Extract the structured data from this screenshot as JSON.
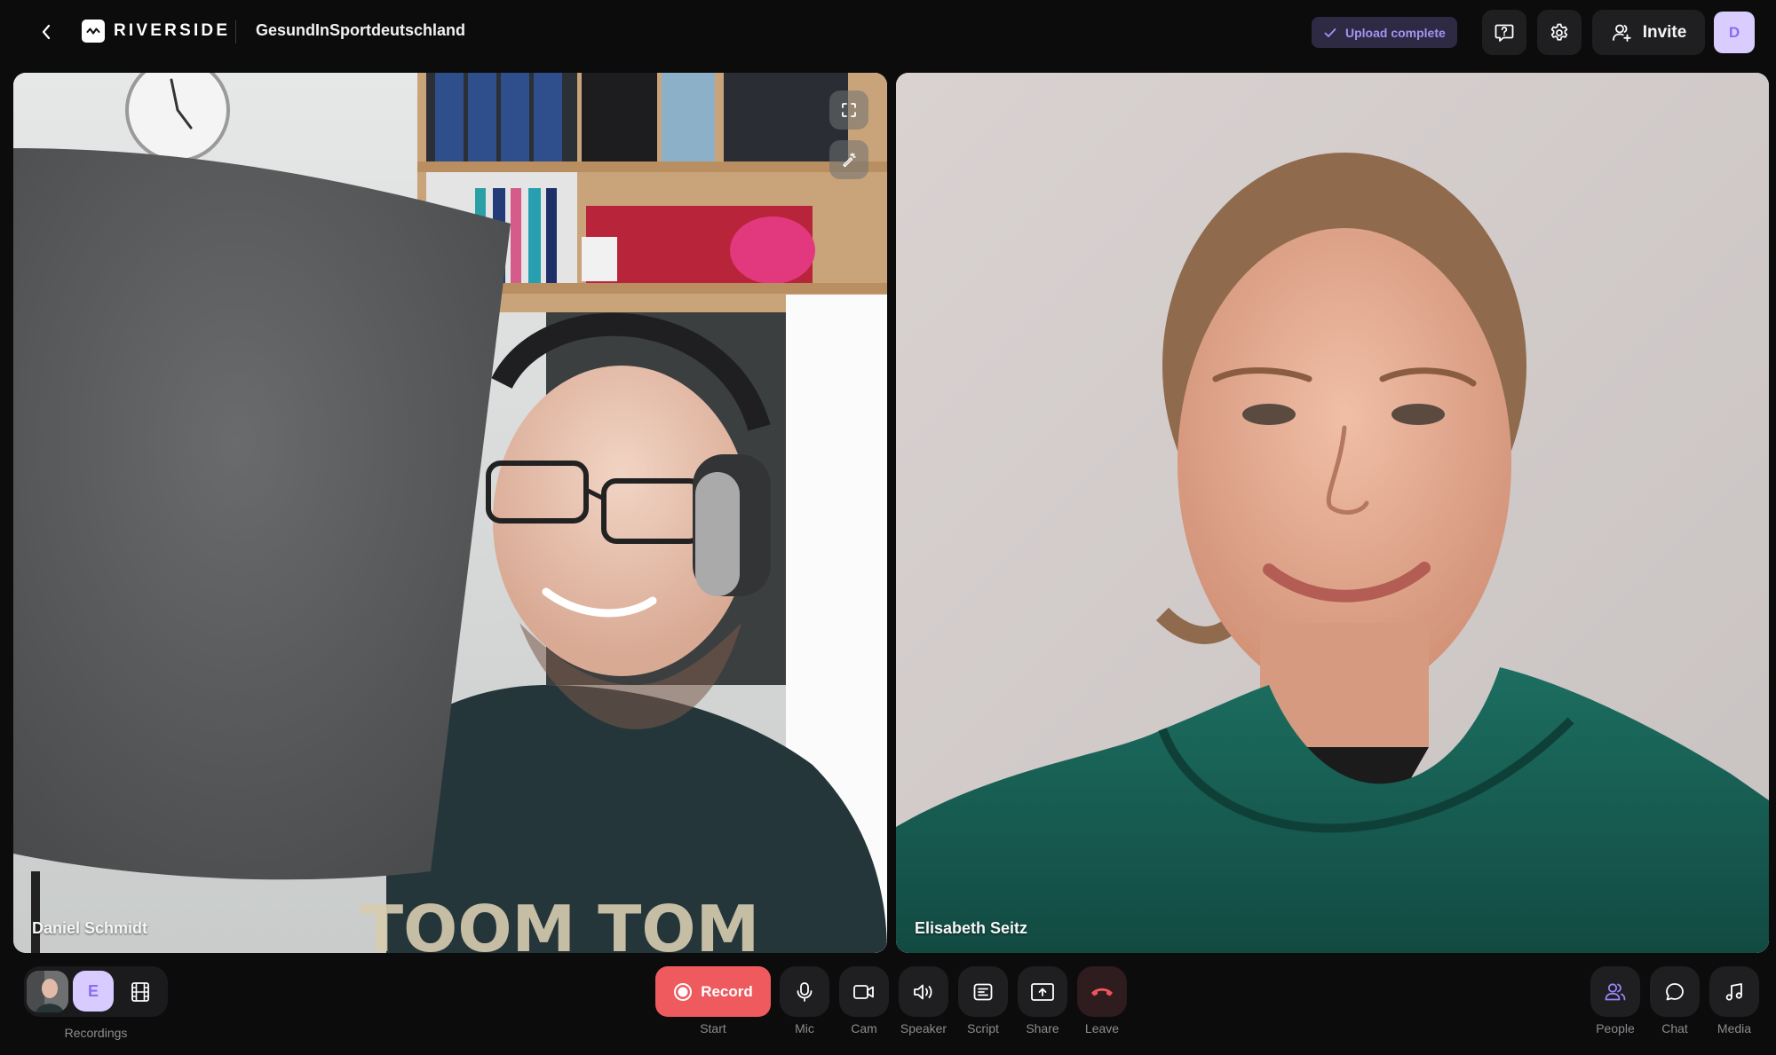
{
  "header": {
    "back_icon": "chevron-left-icon",
    "logo_icon": "riverside-wave-icon",
    "brand": "RIVERSIDE",
    "project_title": "GesundInSportdeutschland",
    "upload_status": {
      "label": "Upload complete",
      "icon": "check-icon"
    },
    "help_icon": "help-chat-icon",
    "settings_icon": "gear-icon",
    "invite": {
      "label": "Invite",
      "icon": "add-user-icon"
    },
    "user_avatar_initial": "D"
  },
  "participants": [
    {
      "name": "Daniel Schmidt",
      "controls": [
        {
          "icon": "fullscreen-icon",
          "label": "Fullscreen"
        },
        {
          "icon": "magic-wand-icon",
          "label": "Effects"
        }
      ]
    },
    {
      "name": "Elisabeth Seitz"
    }
  ],
  "recordings": {
    "label": "Recordings",
    "avatar_initial": "E",
    "film_icon": "film-icon"
  },
  "controls": {
    "record": {
      "button_label": "Record",
      "caption": "Start",
      "icon": "record-dot-icon"
    },
    "mic": {
      "caption": "Mic",
      "icon": "microphone-icon"
    },
    "cam": {
      "caption": "Cam",
      "icon": "video-camera-icon"
    },
    "speaker": {
      "caption": "Speaker",
      "icon": "speaker-icon"
    },
    "script": {
      "caption": "Script",
      "icon": "script-icon"
    },
    "share": {
      "caption": "Share",
      "icon": "share-screen-icon"
    },
    "leave": {
      "caption": "Leave",
      "icon": "hang-up-icon"
    },
    "people": {
      "caption": "People",
      "icon": "people-icon"
    },
    "chat": {
      "caption": "Chat",
      "icon": "chat-bubble-icon"
    },
    "media": {
      "caption": "Media",
      "icon": "music-note-icon"
    }
  },
  "colors": {
    "background": "#0c0c0d",
    "accent_purple": "#8b6ef0",
    "record_red": "#ef5a5f",
    "upload_badge_bg": "#2e2a44",
    "upload_badge_text": "#a593f2"
  }
}
